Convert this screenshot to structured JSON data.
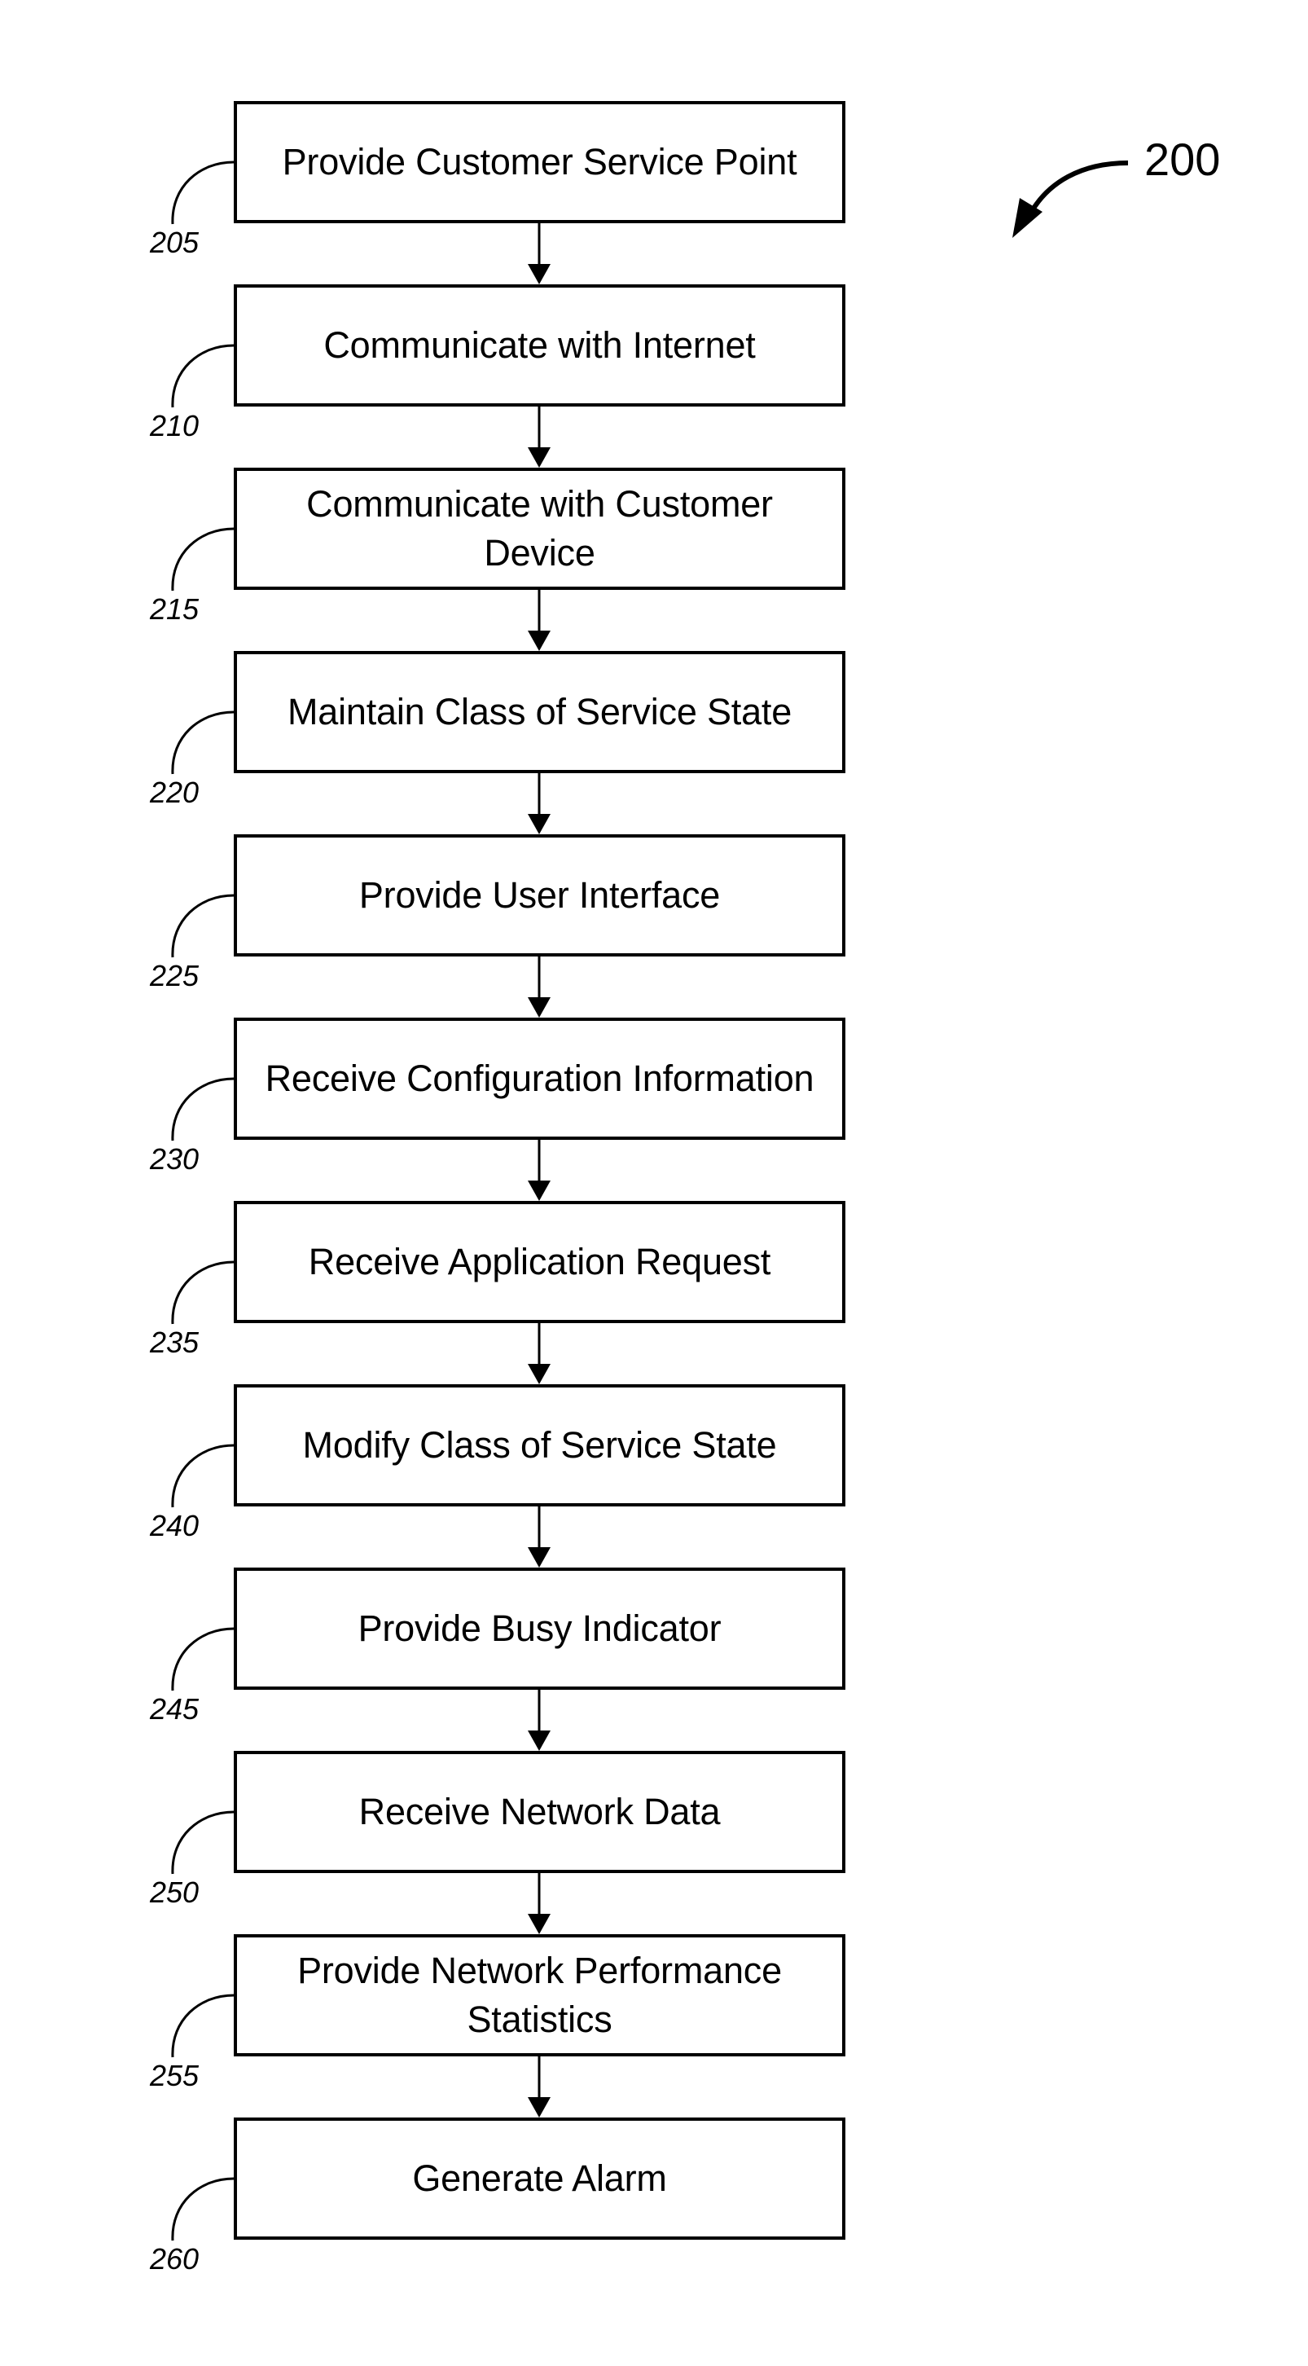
{
  "figure": {
    "reference": "200",
    "steps": [
      {
        "ref": "205",
        "text": "Provide Customer Service Point"
      },
      {
        "ref": "210",
        "text": "Communicate with Internet"
      },
      {
        "ref": "215",
        "text": "Communicate with Customer Device"
      },
      {
        "ref": "220",
        "text": "Maintain Class of Service State"
      },
      {
        "ref": "225",
        "text": "Provide User Interface"
      },
      {
        "ref": "230",
        "text": "Receive Configuration Information"
      },
      {
        "ref": "235",
        "text": "Receive Application Request"
      },
      {
        "ref": "240",
        "text": "Modify Class of Service State"
      },
      {
        "ref": "245",
        "text": "Provide Busy Indicator"
      },
      {
        "ref": "250",
        "text": "Receive Network Data"
      },
      {
        "ref": "255",
        "text": "Provide Network Performance Statistics"
      },
      {
        "ref": "260",
        "text": "Generate Alarm"
      }
    ]
  }
}
